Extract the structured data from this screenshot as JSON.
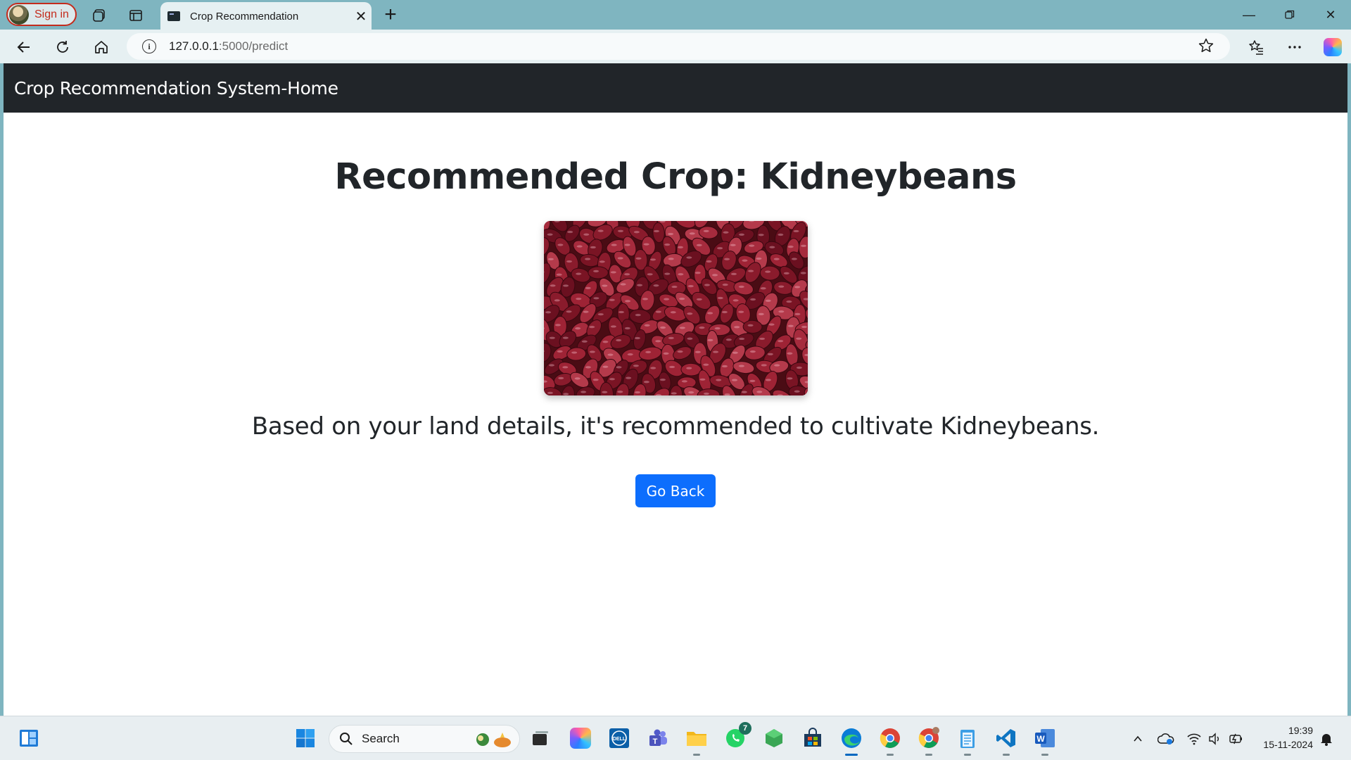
{
  "browser": {
    "signin_label": "Sign in",
    "tab_title": "Crop Recommendation",
    "url_host": "127.0.0.1",
    "url_path": ":5000/predict"
  },
  "page": {
    "brand": "Crop Recommendation System-Home",
    "heading": "Recommended Crop: Kidneybeans",
    "message": "Based on your land details, it's recommended to cultivate Kidneybeans.",
    "button_label": "Go Back",
    "image_subject": "kidney beans photo",
    "accent_color": "#0d6efd",
    "navbar_color": "#212529"
  },
  "taskbar": {
    "search_label": "Search",
    "whatsapp_badge": "7",
    "time": "19:39",
    "date": "15-11-2024",
    "pinned": [
      "widgets-icon",
      "windows-start-icon",
      "search-icon",
      "task-view-icon",
      "copilot-icon",
      "dell-icon",
      "teams-icon",
      "file-explorer-icon",
      "whatsapp-icon",
      "cube-app-icon",
      "store-icon",
      "edge-icon",
      "chrome-icon",
      "chrome-profile-icon",
      "notepad-icon",
      "vscode-icon",
      "word-icon"
    ]
  }
}
